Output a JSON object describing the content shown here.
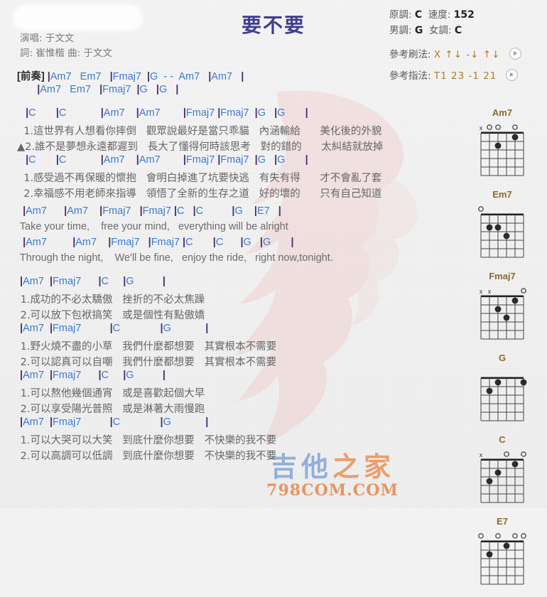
{
  "header": {
    "title": "要不要",
    "singer_line": "演唱: 于文文",
    "writer_line": "詞: 崔惟楷  曲: 于文文",
    "blurred_box": ""
  },
  "key_info": {
    "orig_label": "原調:",
    "orig_value": "C",
    "tempo_label": "速度:",
    "tempo_value": "152",
    "male_label": "男調:",
    "male_value": "G",
    "female_label": "女調:",
    "female_value": "C"
  },
  "patterns": {
    "strum_label": "參考刷法:",
    "strum_value": "X ↑↓ -↓ ↑↓",
    "fingerstyle_label": "參考指法:",
    "fingerstyle_value": "T1 23 -1 21",
    "play_icon": "play-icon"
  },
  "watermark": {
    "site_cn_1": "吉",
    "site_cn_2": "他",
    "site_cn_3": "之家",
    "site_domain": "798COM.COM"
  },
  "sections": [
    {
      "type": "intro",
      "lines": [
        {
          "kind": "chord",
          "tag": "[前奏]",
          "text": " |Am7   Em7   |Fmaj7  |G  - -  Am7   |Am7   |"
        },
        {
          "kind": "chord",
          "tag": "",
          "text": "       |Am7   Em7   |Fmaj7  |G   |G   |"
        }
      ]
    },
    {
      "type": "verse",
      "lines": [
        {
          "kind": "chord",
          "text": "   |C       |C            |Am7    |Am7        |Fmaj7 |Fmaj7  |G   |G       |"
        },
        {
          "kind": "lyric",
          "text": "  1.這世界有人想看你摔倒   觀眾說最好是當只乖貓   內涵輸給      美化後的外貌"
        },
        {
          "kind": "lyric",
          "text": "▲2.誰不是夢想永遠都遲到   長大了懂得何時該思考   對的錯的      太糾結就放掉"
        },
        {
          "kind": "chord",
          "text": "   |C       |C            |Am7    |Am7        |Fmaj7 |Fmaj7  |G   |G       |"
        },
        {
          "kind": "lyric",
          "text": "  1.感受過不再保暖的懷抱   會明白掉進了坑要快逃   有失有得      才不會亂了套"
        },
        {
          "kind": "lyric",
          "text": "  2.幸福感不用老師來指導   領悟了全新的生存之道   好的壞的      只有自己知道"
        }
      ]
    },
    {
      "type": "chorus-en",
      "lines": [
        {
          "kind": "chord",
          "text": "  |Am7      |Am7    |Fmaj7   |Fmaj7 |C   |C          |G    |E7   |"
        },
        {
          "kind": "lyric-en",
          "text": " Take your time,    free your mind,   everything will be alright"
        },
        {
          "kind": "chord",
          "text": "  |Am7         |Am7    |Fmaj7   |Fmaj7 |C       |C      |G   |G       |"
        },
        {
          "kind": "lyric-en",
          "text": " Through the night,    We'll be fine,   enjoy the ride,   right now,tonight."
        }
      ]
    },
    {
      "type": "bridge",
      "lines": [
        {
          "kind": "chord",
          "text": " |Am7  |Fmaj7      |C     |G          |"
        },
        {
          "kind": "lyric",
          "text": " 1.成功的不必太驕傲   挫折的不必太焦躁"
        },
        {
          "kind": "lyric",
          "text": " 2.可以放下包袱搞笑   或是個性有點傲嬌"
        },
        {
          "kind": "chord",
          "text": " |Am7  |Fmaj7          |C              |G            |"
        },
        {
          "kind": "lyric",
          "text": " 1.野火燒不盡的小草   我們什麼都想要   其實根本不需要"
        },
        {
          "kind": "lyric",
          "text": " 2.可以認真可以自嘲   我們什麼都想要   其實根本不需要"
        },
        {
          "kind": "chord",
          "text": " |Am7  |Fmaj7      |C     |G          |"
        },
        {
          "kind": "lyric",
          "text": " 1.可以熬他幾個通宵   或是喜歡起個大早"
        },
        {
          "kind": "lyric",
          "text": " 2.可以享受陽光普照   或是淋著大雨慢跑"
        },
        {
          "kind": "chord",
          "text": " |Am7  |Fmaj7          |C              |G            |"
        },
        {
          "kind": "lyric",
          "text": " 1.可以大哭可以大笑   到底什麼你想要   不快樂的我不要"
        },
        {
          "kind": "lyric",
          "text": " 2.可以高調可以低調   到底什麼你想要   不快樂的我不要"
        }
      ]
    }
  ],
  "chord_diagrams": [
    {
      "name": "Am7",
      "top": [
        "x",
        "o",
        "o",
        "",
        "o",
        ""
      ],
      "dots": [
        {
          "string": 3,
          "fret": 2
        },
        {
          "string": 5,
          "fret": 1
        }
      ]
    },
    {
      "name": "Em7",
      "top": [
        "o",
        "",
        "",
        "",
        "",
        ""
      ],
      "dots": [
        {
          "string": 2,
          "fret": 2
        },
        {
          "string": 3,
          "fret": 2
        },
        {
          "string": 4,
          "fret": 3
        }
      ]
    },
    {
      "name": "Fmaj7",
      "top": [
        "x",
        "x",
        "",
        "",
        "",
        "o"
      ],
      "dots": [
        {
          "string": 3,
          "fret": 2
        },
        {
          "string": 4,
          "fret": 3
        },
        {
          "string": 5,
          "fret": 1
        }
      ]
    },
    {
      "name": "G",
      "top": [
        "",
        "",
        "",
        "",
        "",
        ""
      ],
      "dots": [
        {
          "string": 2,
          "fret": 2
        },
        {
          "string": 3,
          "fret": 1
        },
        {
          "string": 6,
          "fret": 1
        }
      ]
    },
    {
      "name": "C",
      "top": [
        "x",
        "",
        "",
        "o",
        "",
        "o"
      ],
      "dots": [
        {
          "string": 2,
          "fret": 3
        },
        {
          "string": 3,
          "fret": 2
        },
        {
          "string": 5,
          "fret": 1
        }
      ]
    },
    {
      "name": "E7",
      "top": [
        "o",
        "",
        "o",
        "",
        "o",
        "o"
      ],
      "dots": [
        {
          "string": 2,
          "fret": 2
        },
        {
          "string": 4,
          "fret": 1
        }
      ]
    }
  ],
  "colors": {
    "title": "#3f3f8f",
    "chord": "#3a7ad1",
    "bar": "#4b2f6e",
    "lyric": "#666666",
    "chord_name": "#8a6a2e",
    "watermark_orange": "#e87d3e",
    "background": "#f2f2f2"
  }
}
